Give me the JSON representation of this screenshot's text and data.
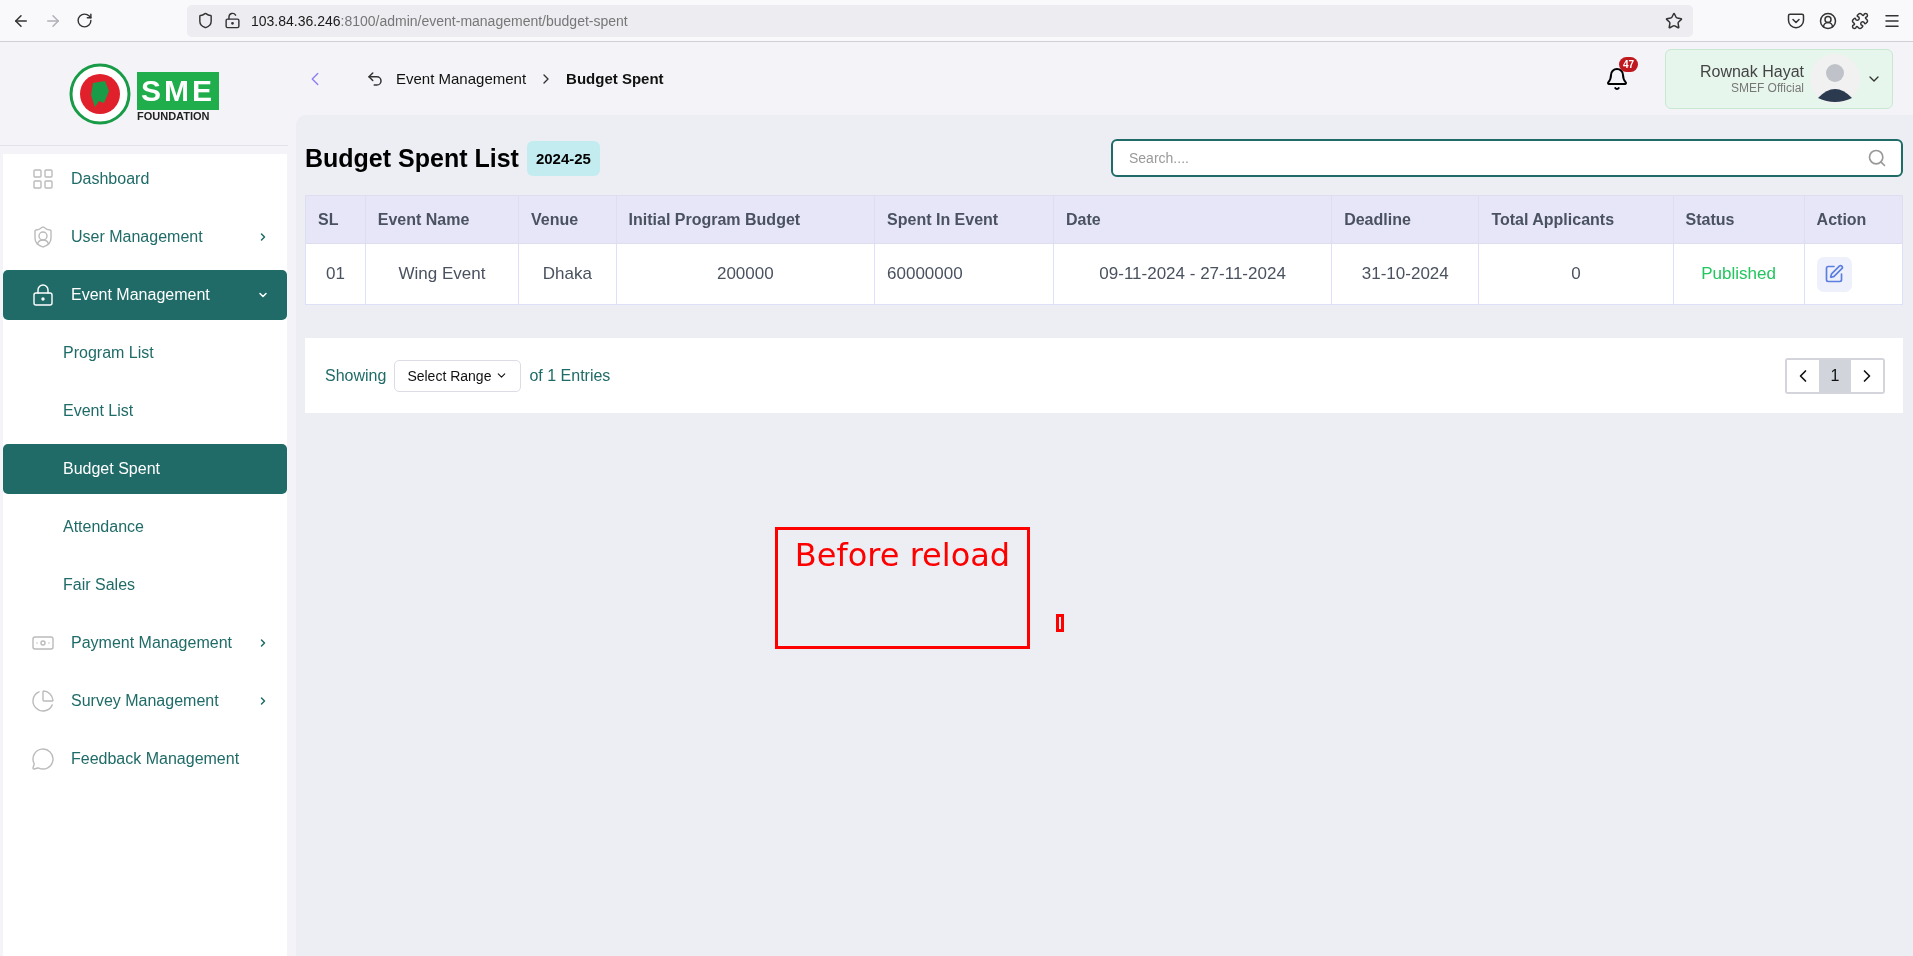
{
  "browser": {
    "url_host": "103.84.36.246",
    "url_path": ":8100/admin/event-management/budget-spent"
  },
  "logo": {
    "letters": "SME",
    "tagline": "FOUNDATION"
  },
  "sidebar": {
    "items": [
      {
        "label": "Dashboard",
        "kind": "link",
        "selected": false
      },
      {
        "label": "User Management",
        "kind": "group",
        "expanded": false,
        "selected": false
      },
      {
        "label": "Event Management",
        "kind": "group",
        "expanded": true,
        "selected": true,
        "children": [
          {
            "label": "Program List",
            "selected": false
          },
          {
            "label": "Event List",
            "selected": false
          },
          {
            "label": "Budget Spent",
            "selected": true
          },
          {
            "label": "Attendance",
            "selected": false
          },
          {
            "label": "Fair Sales",
            "selected": false
          }
        ]
      },
      {
        "label": "Payment Management",
        "kind": "group",
        "expanded": false,
        "selected": false
      },
      {
        "label": "Survey Management",
        "kind": "group",
        "expanded": false,
        "selected": false
      },
      {
        "label": "Feedback Management",
        "kind": "link",
        "selected": false
      }
    ]
  },
  "header": {
    "breadcrumb": [
      "Event Management",
      "Budget Spent"
    ],
    "notifications": "47",
    "user": {
      "name": "Rownak Hayat",
      "role": "SMEF Official"
    }
  },
  "page": {
    "title": "Budget Spent List",
    "year": "2024-25",
    "search": {
      "placeholder": "Search...."
    }
  },
  "table": {
    "columns": [
      "SL",
      "Event Name",
      "Venue",
      "Initial Program Budget",
      "Spent In Event",
      "Date",
      "Deadline",
      "Total Applicants",
      "Status",
      "Action"
    ],
    "rows": [
      {
        "cells": [
          "01",
          "Wing Event",
          "Dhaka",
          "200000",
          "60000000",
          "09-11-2024 - 27-11-2024",
          "31-10-2024",
          "0",
          "Published"
        ]
      }
    ]
  },
  "pagination": {
    "showing": "Showing",
    "range": "Select Range",
    "entries": "of 1 Entries",
    "pages": [
      {
        "label": "1",
        "selected": true
      }
    ]
  },
  "annotation": {
    "label": "Before reload"
  }
}
